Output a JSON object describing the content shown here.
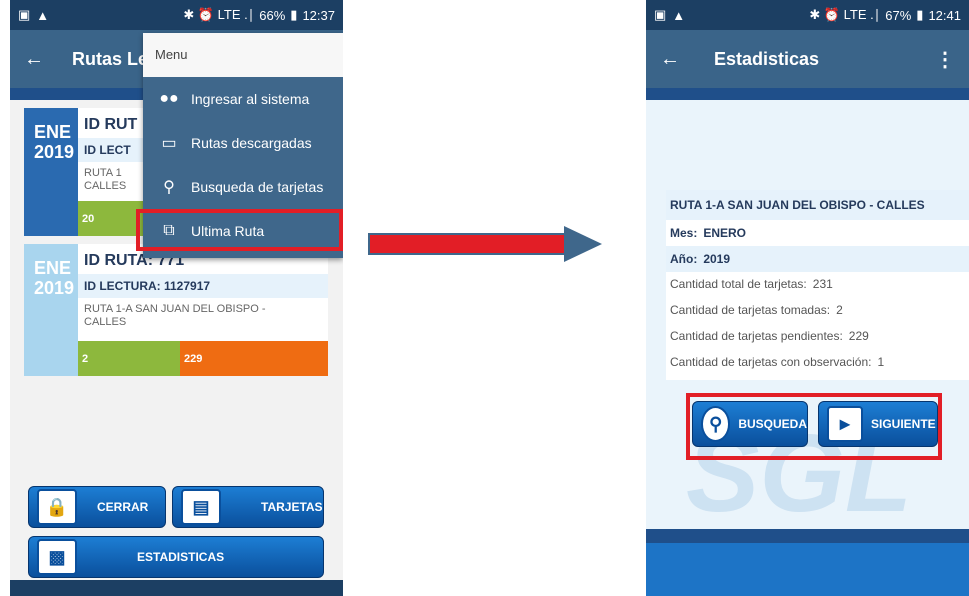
{
  "left": {
    "status": {
      "signal": "▲",
      "icons": "✱ ⏰ LTE .∣",
      "battery": "66%",
      "time": "12:37"
    },
    "app_bar": {
      "back": "←",
      "title": "Rutas Le"
    },
    "menu": {
      "title": "Menu",
      "items": [
        {
          "label": "Ingresar al sistema",
          "icon": "users-icon"
        },
        {
          "label": "Rutas descargadas",
          "icon": "folder-icon"
        },
        {
          "label": "Busqueda de tarjetas",
          "icon": "search-icon"
        },
        {
          "label": "Ultima Ruta",
          "icon": "cards-icon"
        }
      ]
    },
    "cards": [
      {
        "month": "ENE",
        "year": "2019",
        "id_ruta": "ID RUT",
        "id_lectura": "ID LECT",
        "ruta": "RUTA 1\nCALLES",
        "done": "20",
        "pending": ""
      },
      {
        "month": "ENE",
        "year": "2019",
        "id_ruta": "ID RUTA: 771",
        "id_lectura": "ID LECTURA: 1127917",
        "ruta": "RUTA 1-A SAN JUAN DEL OBISPO -\nCALLES",
        "done": "2",
        "pending": "229"
      }
    ],
    "buttons": {
      "close": "CERRAR",
      "cards": "TARJETAS",
      "stats": "ESTADISTICAS"
    }
  },
  "right": {
    "status": {
      "signal": "▲",
      "icons": "✱ ⏰ LTE .∣",
      "battery": "67%",
      "time": "12:41"
    },
    "app_bar": {
      "back": "←",
      "title": "Estadisticas",
      "more": "⋮"
    },
    "stats": {
      "title": "RUTA 1-A SAN JUAN DEL OBISPO - CALLES",
      "mes_label": "Mes:",
      "mes": "ENERO",
      "anio_label": "Año:",
      "anio": "2019",
      "lines": [
        {
          "label": "Cantidad total de tarjetas:",
          "value": "231"
        },
        {
          "label": "Cantidad de tarjetas tomadas:",
          "value": "2"
        },
        {
          "label": "Cantidad de tarjetas pendientes:",
          "value": "229"
        },
        {
          "label": "Cantidad de tarjetas con observación:",
          "value": "1"
        }
      ]
    },
    "buttons": {
      "search": "BUSQUEDA",
      "next": "SIGUIENTE"
    },
    "watermark": "SGL"
  },
  "colors": {
    "app_bar": "#3a6489",
    "status_bar": "#1c3f63",
    "accent_red": "#e21e26",
    "done": "#8db83d",
    "pending": "#ef6c12"
  }
}
